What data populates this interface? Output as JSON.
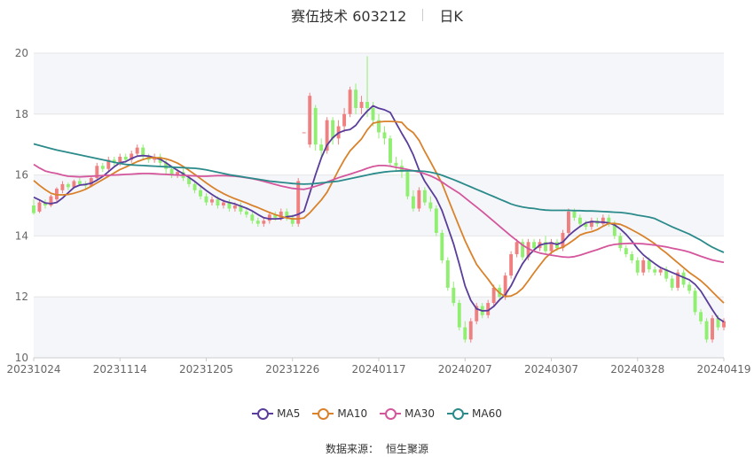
{
  "header": {
    "title": "赛伍技术 603212",
    "period": "日K"
  },
  "source": {
    "label": "数据来源：",
    "name": "恒生聚源"
  },
  "colors": {
    "up": "#f08080",
    "down": "#90ee70",
    "grid": "#e6e6e6",
    "band": "#f5f6fa",
    "axis_text": "#666666"
  },
  "chart_data": {
    "type": "candlestick",
    "ylim": [
      10,
      20
    ],
    "yticks": [
      10,
      12,
      14,
      16,
      18,
      20
    ],
    "xtick_labels": [
      "20231024",
      "20231114",
      "20231205",
      "20231226",
      "20240117",
      "20240207",
      "20240307",
      "20240328",
      "20240419"
    ],
    "xtick_index": [
      0,
      15,
      30,
      45,
      60,
      75,
      90,
      105,
      120
    ],
    "candles": [
      [
        15.0,
        14.75,
        15.2,
        14.7
      ],
      [
        14.8,
        15.1,
        15.2,
        14.75
      ],
      [
        15.1,
        15.0,
        15.2,
        14.9
      ],
      [
        15.0,
        15.3,
        15.35,
        14.95
      ],
      [
        15.2,
        15.55,
        15.6,
        15.1
      ],
      [
        15.5,
        15.7,
        15.8,
        15.4
      ],
      [
        15.7,
        15.6,
        15.75,
        15.5
      ],
      [
        15.6,
        15.8,
        15.85,
        15.55
      ],
      [
        15.8,
        15.7,
        15.9,
        15.65
      ],
      [
        15.7,
        15.65,
        15.8,
        15.55
      ],
      [
        15.65,
        15.9,
        15.95,
        15.6
      ],
      [
        15.9,
        16.3,
        16.4,
        15.85
      ],
      [
        16.3,
        16.2,
        16.4,
        16.1
      ],
      [
        16.2,
        16.5,
        16.6,
        16.1
      ],
      [
        16.5,
        16.4,
        16.6,
        16.3
      ],
      [
        16.4,
        16.6,
        16.7,
        16.3
      ],
      [
        16.6,
        16.5,
        16.7,
        16.4
      ],
      [
        16.5,
        16.7,
        16.8,
        16.4
      ],
      [
        16.7,
        16.9,
        17.0,
        16.6
      ],
      [
        16.9,
        16.6,
        17.0,
        16.5
      ],
      [
        16.6,
        16.5,
        16.7,
        16.4
      ],
      [
        16.5,
        16.6,
        16.7,
        16.4
      ],
      [
        16.6,
        16.4,
        16.7,
        16.3
      ],
      [
        16.4,
        16.2,
        16.5,
        16.0
      ],
      [
        16.2,
        16.0,
        16.3,
        15.9
      ],
      [
        16.0,
        16.1,
        16.2,
        15.9
      ],
      [
        16.1,
        15.9,
        16.2,
        15.8
      ],
      [
        15.9,
        15.7,
        16.0,
        15.6
      ],
      [
        15.7,
        15.5,
        15.8,
        15.4
      ],
      [
        15.5,
        15.3,
        15.6,
        15.2
      ],
      [
        15.3,
        15.1,
        15.4,
        15.0
      ],
      [
        15.1,
        15.2,
        15.3,
        15.0
      ],
      [
        15.2,
        15.0,
        15.3,
        14.9
      ],
      [
        15.0,
        15.1,
        15.2,
        14.9
      ],
      [
        15.1,
        14.9,
        15.2,
        14.8
      ],
      [
        14.9,
        15.0,
        15.1,
        14.8
      ],
      [
        15.0,
        14.8,
        15.1,
        14.7
      ],
      [
        14.8,
        14.7,
        14.9,
        14.6
      ],
      [
        14.7,
        14.5,
        14.8,
        14.4
      ],
      [
        14.5,
        14.4,
        14.6,
        14.3
      ],
      [
        14.4,
        14.5,
        14.6,
        14.3
      ],
      [
        14.5,
        14.7,
        14.8,
        14.4
      ],
      [
        14.7,
        14.6,
        14.8,
        14.5
      ],
      [
        14.6,
        14.8,
        14.9,
        14.5
      ],
      [
        14.8,
        14.6,
        14.9,
        14.5
      ],
      [
        14.6,
        14.4,
        14.7,
        14.3
      ],
      [
        14.4,
        15.8,
        15.9,
        14.3
      ],
      [
        17.4,
        17.4,
        17.4,
        17.4
      ],
      [
        17.0,
        18.6,
        18.7,
        16.9
      ],
      [
        18.2,
        17.0,
        18.3,
        16.8
      ],
      [
        17.0,
        16.8,
        17.2,
        16.6
      ],
      [
        16.8,
        17.8,
        17.9,
        16.7
      ],
      [
        17.8,
        17.2,
        17.9,
        17.0
      ],
      [
        17.2,
        17.6,
        17.8,
        17.0
      ],
      [
        17.6,
        18.0,
        18.2,
        17.4
      ],
      [
        18.0,
        18.8,
        18.9,
        17.9
      ],
      [
        18.8,
        18.2,
        19.0,
        18.0
      ],
      [
        18.2,
        18.4,
        18.6,
        18.0
      ],
      [
        18.4,
        18.2,
        19.9,
        17.9
      ],
      [
        18.2,
        17.8,
        18.4,
        17.6
      ],
      [
        17.8,
        17.4,
        18.0,
        17.2
      ],
      [
        17.4,
        17.2,
        17.6,
        17.0
      ],
      [
        17.2,
        16.4,
        17.3,
        16.3
      ],
      [
        16.4,
        16.3,
        16.6,
        16.1
      ],
      [
        16.3,
        16.1,
        16.5,
        15.9
      ],
      [
        16.1,
        15.3,
        16.2,
        15.2
      ],
      [
        15.3,
        14.9,
        15.5,
        14.8
      ],
      [
        14.9,
        15.5,
        15.6,
        14.8
      ],
      [
        15.5,
        15.1,
        15.6,
        15.0
      ],
      [
        15.1,
        14.9,
        15.3,
        14.8
      ],
      [
        14.9,
        14.1,
        15.0,
        14.0
      ],
      [
        14.1,
        13.2,
        14.2,
        13.1
      ],
      [
        13.2,
        12.3,
        13.3,
        12.2
      ],
      [
        12.3,
        11.8,
        12.5,
        11.7
      ],
      [
        11.8,
        11.0,
        11.9,
        10.9
      ],
      [
        11.0,
        10.6,
        11.2,
        10.5
      ],
      [
        10.6,
        11.2,
        11.3,
        10.5
      ],
      [
        11.2,
        11.7,
        11.8,
        11.1
      ],
      [
        11.7,
        11.4,
        11.8,
        11.3
      ],
      [
        11.4,
        11.8,
        11.9,
        11.3
      ],
      [
        11.8,
        12.3,
        12.4,
        11.7
      ],
      [
        12.3,
        12.0,
        12.4,
        11.9
      ],
      [
        12.0,
        12.7,
        12.8,
        11.9
      ],
      [
        12.7,
        13.4,
        13.5,
        12.6
      ],
      [
        13.4,
        13.8,
        13.9,
        13.3
      ],
      [
        13.8,
        13.3,
        13.9,
        13.2
      ],
      [
        13.3,
        13.8,
        13.9,
        13.2
      ],
      [
        13.8,
        13.6,
        13.9,
        13.5
      ],
      [
        13.6,
        13.8,
        13.9,
        13.5
      ],
      [
        13.8,
        13.5,
        14.0,
        13.4
      ],
      [
        13.5,
        13.8,
        13.9,
        13.4
      ],
      [
        13.8,
        13.6,
        13.9,
        13.5
      ],
      [
        13.6,
        14.1,
        14.2,
        13.5
      ],
      [
        14.1,
        14.8,
        14.9,
        14.0
      ],
      [
        14.8,
        14.6,
        14.9,
        14.5
      ],
      [
        14.6,
        14.4,
        14.7,
        14.3
      ],
      [
        14.4,
        14.3,
        14.5,
        14.2
      ],
      [
        14.3,
        14.5,
        14.6,
        14.2
      ],
      [
        14.5,
        14.4,
        14.6,
        14.3
      ],
      [
        14.4,
        14.6,
        14.7,
        14.3
      ],
      [
        14.6,
        14.4,
        14.7,
        14.3
      ],
      [
        14.4,
        14.0,
        14.5,
        13.9
      ],
      [
        14.0,
        13.6,
        14.1,
        13.5
      ],
      [
        13.6,
        13.4,
        13.7,
        13.3
      ],
      [
        13.4,
        13.2,
        13.5,
        13.1
      ],
      [
        13.2,
        12.8,
        13.3,
        12.7
      ],
      [
        12.8,
        13.2,
        13.3,
        12.7
      ],
      [
        13.2,
        12.9,
        13.3,
        12.8
      ],
      [
        12.9,
        12.8,
        13.0,
        12.7
      ],
      [
        12.8,
        12.9,
        13.0,
        12.7
      ],
      [
        12.9,
        12.6,
        13.0,
        12.5
      ],
      [
        12.6,
        12.3,
        12.7,
        12.2
      ],
      [
        12.3,
        12.8,
        12.9,
        12.2
      ],
      [
        12.8,
        12.4,
        12.9,
        12.3
      ],
      [
        12.4,
        12.2,
        12.5,
        12.1
      ],
      [
        12.2,
        11.5,
        12.3,
        11.4
      ],
      [
        11.5,
        11.2,
        11.6,
        11.1
      ],
      [
        11.2,
        10.6,
        11.3,
        10.5
      ],
      [
        10.6,
        11.3,
        11.4,
        10.5
      ],
      [
        11.3,
        11.0,
        11.4,
        10.9
      ],
      [
        11.0,
        11.2,
        11.3,
        10.9
      ]
    ],
    "series": [
      {
        "name": "MA5",
        "color": "#5a3d9a",
        "values": [
          15.27,
          15.18,
          15.08,
          15.06,
          15.1,
          15.24,
          15.42,
          15.59,
          15.67,
          15.69,
          15.73,
          15.83,
          15.95,
          16.11,
          16.27,
          16.4,
          16.44,
          16.54,
          16.62,
          16.64,
          16.62,
          16.57,
          16.52,
          16.4,
          16.27,
          16.15,
          16.04,
          15.92,
          15.79,
          15.64,
          15.49,
          15.36,
          15.24,
          15.15,
          15.1,
          15.05,
          14.98,
          14.91,
          14.82,
          14.7,
          14.6,
          14.56,
          14.56,
          14.57,
          14.63,
          14.65,
          14.71,
          14.81,
          15.4,
          16.01,
          16.56,
          16.98,
          17.22,
          17.38,
          17.46,
          17.49,
          17.63,
          17.89,
          18.1,
          18.27,
          18.19,
          18.14,
          18.05,
          17.71,
          17.37,
          17.05,
          16.66,
          16.17,
          15.79,
          15.51,
          15.23,
          14.83,
          14.29,
          13.74,
          13.07,
          12.36,
          11.89,
          11.61,
          11.54,
          11.55,
          11.69,
          11.9,
          12.07,
          12.36,
          12.74,
          13.09,
          13.35,
          13.54,
          13.7,
          13.75,
          13.77,
          13.72,
          13.8,
          14.01,
          14.17,
          14.31,
          14.43,
          14.47,
          14.46,
          14.45,
          14.43,
          14.36,
          14.23,
          14.05,
          13.83,
          13.58,
          13.38,
          13.23,
          13.09,
          12.96,
          12.88,
          12.8,
          12.72,
          12.64,
          12.56,
          12.41,
          12.19,
          11.89,
          11.58,
          11.3,
          11.18
        ]
      },
      {
        "name": "MA10",
        "color": "#d9822b",
        "values": [
          15.82,
          15.66,
          15.52,
          15.4,
          15.35,
          15.35,
          15.36,
          15.4,
          15.46,
          15.53,
          15.63,
          15.74,
          15.85,
          15.96,
          16.07,
          16.18,
          16.26,
          16.35,
          16.44,
          16.51,
          16.56,
          16.57,
          16.56,
          16.53,
          16.47,
          16.39,
          16.28,
          16.15,
          16.02,
          15.88,
          15.74,
          15.61,
          15.49,
          15.39,
          15.3,
          15.22,
          15.15,
          15.08,
          15.0,
          14.93,
          14.85,
          14.77,
          14.7,
          14.64,
          14.59,
          14.56,
          14.56,
          14.59,
          14.76,
          14.97,
          15.18,
          15.43,
          15.79,
          16.16,
          16.5,
          16.79,
          16.99,
          17.19,
          17.48,
          17.7,
          17.74,
          17.76,
          17.76,
          17.75,
          17.73,
          17.52,
          17.39,
          17.14,
          16.77,
          16.43,
          16.08,
          15.72,
          15.24,
          14.77,
          14.3,
          13.84,
          13.45,
          13.07,
          12.82,
          12.58,
          12.32,
          12.13,
          12.01,
          12.03,
          12.12,
          12.28,
          12.53,
          12.79,
          13.04,
          13.28,
          13.45,
          13.57,
          13.63,
          13.75,
          13.88,
          14.03,
          14.1,
          14.14,
          14.21,
          14.32,
          14.41,
          14.41,
          14.38,
          14.3,
          14.2,
          14.1,
          13.99,
          13.87,
          13.74,
          13.58,
          13.44,
          13.28,
          13.12,
          12.96,
          12.8,
          12.67,
          12.53,
          12.36,
          12.17,
          11.98,
          11.8
        ]
      },
      {
        "name": "MA30",
        "color": "#d4569c",
        "values": [
          16.35,
          16.23,
          16.13,
          16.08,
          16.05,
          16.0,
          15.96,
          15.95,
          15.94,
          15.95,
          15.96,
          15.97,
          15.98,
          15.99,
          16.0,
          16.01,
          16.02,
          16.03,
          16.04,
          16.05,
          16.05,
          16.04,
          16.03,
          16.02,
          16.01,
          16.0,
          15.99,
          15.98,
          15.97,
          15.96,
          15.96,
          15.97,
          15.98,
          15.98,
          15.97,
          15.96,
          15.94,
          15.91,
          15.88,
          15.84,
          15.79,
          15.74,
          15.69,
          15.64,
          15.6,
          15.56,
          15.54,
          15.53,
          15.57,
          15.63,
          15.69,
          15.77,
          15.84,
          15.91,
          15.97,
          16.03,
          16.09,
          16.15,
          16.22,
          16.28,
          16.31,
          16.31,
          16.29,
          16.25,
          16.22,
          16.18,
          16.14,
          16.1,
          16.04,
          15.97,
          15.88,
          15.77,
          15.64,
          15.52,
          15.4,
          15.25,
          15.1,
          14.95,
          14.8,
          14.64,
          14.48,
          14.32,
          14.16,
          14.0,
          13.85,
          13.7,
          13.58,
          13.5,
          13.44,
          13.4,
          13.37,
          13.34,
          13.31,
          13.3,
          13.32,
          13.37,
          13.43,
          13.49,
          13.55,
          13.62,
          13.68,
          13.72,
          13.74,
          13.75,
          13.76,
          13.75,
          13.74,
          13.72,
          13.7,
          13.67,
          13.64,
          13.6,
          13.56,
          13.52,
          13.47,
          13.4,
          13.33,
          13.27,
          13.21,
          13.17,
          13.13
        ]
      },
      {
        "name": "MA60",
        "color": "#2b8a8a",
        "values": [
          17.02,
          16.97,
          16.92,
          16.87,
          16.82,
          16.78,
          16.74,
          16.7,
          16.66,
          16.62,
          16.58,
          16.54,
          16.5,
          16.46,
          16.42,
          16.38,
          16.35,
          16.33,
          16.32,
          16.31,
          16.3,
          16.29,
          16.28,
          16.27,
          16.26,
          16.25,
          16.24,
          16.23,
          16.22,
          16.2,
          16.17,
          16.13,
          16.09,
          16.05,
          16.01,
          15.98,
          15.95,
          15.92,
          15.89,
          15.86,
          15.83,
          15.8,
          15.78,
          15.76,
          15.74,
          15.72,
          15.71,
          15.7,
          15.71,
          15.72,
          15.74,
          15.76,
          15.78,
          15.8,
          15.84,
          15.88,
          15.92,
          15.96,
          16.0,
          16.04,
          16.07,
          16.1,
          16.12,
          16.13,
          16.14,
          16.14,
          16.14,
          16.13,
          16.12,
          16.09,
          16.05,
          15.99,
          15.92,
          15.85,
          15.77,
          15.69,
          15.61,
          15.53,
          15.45,
          15.37,
          15.29,
          15.21,
          15.13,
          15.05,
          14.99,
          14.95,
          14.92,
          14.9,
          14.87,
          14.85,
          14.84,
          14.84,
          14.84,
          14.84,
          14.83,
          14.83,
          14.82,
          14.82,
          14.81,
          14.8,
          14.79,
          14.78,
          14.77,
          14.75,
          14.72,
          14.68,
          14.65,
          14.62,
          14.57,
          14.48,
          14.39,
          14.3,
          14.22,
          14.14,
          14.06,
          13.96,
          13.86,
          13.74,
          13.63,
          13.54,
          13.46
        ]
      }
    ]
  }
}
